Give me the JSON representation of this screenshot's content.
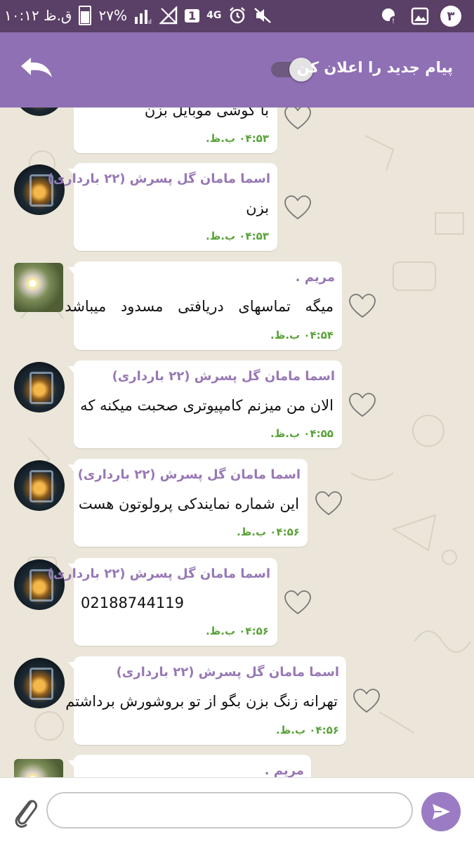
{
  "status_bar": {
    "time": "۱۰:۱۲ ق.ظ",
    "battery": "۲۷%",
    "network": "4G",
    "notification_count": "۳",
    "sim_label": "1"
  },
  "header": {
    "notify_label": "پیام جدید را اعلان کن",
    "toggle_on": true
  },
  "messages": [
    {
      "sender": "",
      "text": "با گوشی موبایل بزن",
      "time": "۰۴:۵۳ ب.ظ.",
      "avatar": "dark"
    },
    {
      "sender": "اسما مامان گل پسرش (۲۲ بارداری)",
      "text": "بزن",
      "time": "۰۴:۵۳ ب.ظ.",
      "avatar": "dark"
    },
    {
      "sender": "مریم .",
      "text": "میگه تماسهای دریافتی مسدود میباشد",
      "time": "۰۴:۵۴ ب.ظ.",
      "avatar": "flower"
    },
    {
      "sender": "اسما مامان گل پسرش (۲۲ بارداری)",
      "text": "الان من میزنم کامپیوتری صحبت میکنه که",
      "time": "۰۴:۵۵ ب.ظ.",
      "avatar": "dark"
    },
    {
      "sender": "اسما مامان گل پسرش (۲۲ بارداری)",
      "text": "این شماره نمایندکی پرولوتون هست",
      "time": "۰۴:۵۶ ب.ظ.",
      "avatar": "dark"
    },
    {
      "sender": "اسما مامان گل پسرش (۲۲ بارداری)",
      "text": "02188744119",
      "time": "۰۴:۵۶ ب.ظ.",
      "avatar": "dark"
    },
    {
      "sender": "اسما مامان گل پسرش (۲۲ بارداری)",
      "text": "تهرانه زنگ بزن بگو از تو بروشورش برداشتم",
      "time": "۰۴:۵۶ ب.ظ.",
      "avatar": "dark"
    },
    {
      "sender": "مریم .",
      "text": "",
      "time": "",
      "avatar": "flower"
    }
  ],
  "composer": {
    "placeholder": "",
    "value": ""
  },
  "colors": {
    "status_bar": "#5a3f66",
    "app_bar": "#8f70b4",
    "sender": "#9777b5",
    "time": "#5aa33a",
    "send_button": "#9b7cc4",
    "chat_bg": "#ebe6d9"
  },
  "icons": [
    "back-arrow-icon",
    "heart-icon",
    "attach-icon",
    "send-icon",
    "alarm-icon",
    "mute-icon",
    "gallery-icon",
    "signal-icon"
  ]
}
